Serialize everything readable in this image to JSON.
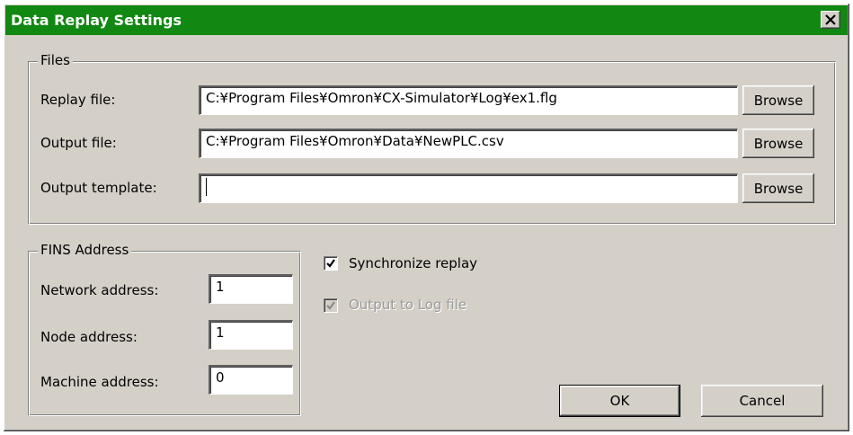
{
  "window": {
    "title": "Data Replay Settings",
    "title_bar_color": "#118811",
    "close_glyph": "×"
  },
  "files": {
    "legend": "Files",
    "replay_label": "Replay file:",
    "replay_value": "C:¥Program Files¥Omron¥CX-Simulator¥Log¥ex1.flg",
    "output_label": "Output file:",
    "output_value": "C:¥Program Files¥Omron¥Data¥NewPLC.csv",
    "template_label": "Output template:",
    "template_value": "",
    "browse_label": "Browse"
  },
  "fins": {
    "legend": "FINS Address",
    "network_label": "Network address:",
    "network_value": "1",
    "node_label": "Node address:",
    "node_value": "1",
    "machine_label": "Machine address:",
    "machine_value": "0"
  },
  "options": {
    "sync_label": "Synchronize replay",
    "sync_checked": true,
    "log_label": "Output to Log file",
    "log_checked": true,
    "log_enabled": false
  },
  "buttons": {
    "ok": "OK",
    "cancel": "Cancel"
  }
}
